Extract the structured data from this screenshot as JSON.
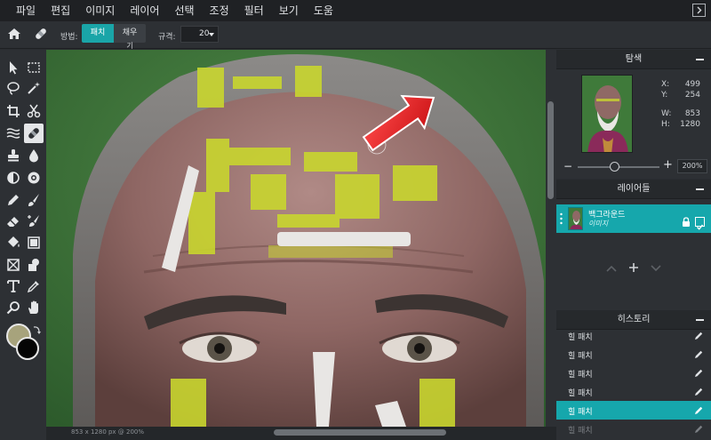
{
  "menubar": {
    "items": [
      "파일",
      "편집",
      "이미지",
      "레이어",
      "선택",
      "조정",
      "필터",
      "보기",
      "도움"
    ],
    "collapse_icon": "chevron-right-box-icon"
  },
  "options": {
    "method_label": "방법:",
    "method_options": [
      "패치",
      "채우"
    ],
    "method_option_b_wrap": "기",
    "method_selected": "패치",
    "size_label": "규격:",
    "size_value": "20"
  },
  "tools": {
    "active": "healing-tool",
    "foreground_color": "#a7a37c",
    "background_color": "#050505"
  },
  "canvas": {
    "status": "853 x 1280 px @ 200%"
  },
  "navigator": {
    "title": "탐색",
    "x_label": "X:",
    "x_value": "499",
    "y_label": "Y:",
    "y_value": "254",
    "w_label": "W:",
    "w_value": "853",
    "h_label": "H:",
    "h_value": "1280",
    "zoom_value": "200%",
    "zoom_level": 0.45
  },
  "layers": {
    "title": "레이어들",
    "items": [
      {
        "name": "백그라운드",
        "type": "이미지",
        "locked": true,
        "visible": true
      }
    ]
  },
  "history": {
    "title": "히스토리",
    "items": [
      "힐 패치",
      "힐 패치",
      "힐 패치",
      "힐 패치",
      "힐 패치",
      "힐 패치"
    ],
    "active_index": 4
  },
  "colors": {
    "accent": "#16a7ac",
    "panel_bg": "#2d3034",
    "menubar_bg": "#1f2124"
  }
}
